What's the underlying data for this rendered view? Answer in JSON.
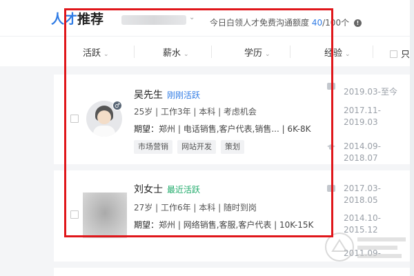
{
  "header": {
    "logo_part1": "人才",
    "logo_part2": "推荐",
    "quota_text": "今日白领人才免费沟通额度",
    "quota_used": "40",
    "quota_total": "/100个"
  },
  "filters": {
    "items": [
      "活跃",
      "薪水",
      "学历",
      "经验"
    ],
    "only_label": "只"
  },
  "candidates": [
    {
      "name": "吴先生",
      "active": "刚刚活跃",
      "meta": "25岁 | 工作3年 | 本科 | 考虑机会",
      "expect_label": "期望：",
      "expect": "郑州 | 电话销售,客户代表,销售... | 6K-8K",
      "tags": [
        "市场营销",
        "网站开发",
        "策划"
      ],
      "experience": [
        "2019.03-至今",
        "2017.11-",
        "2019.03",
        "2014.09-",
        "2018.07"
      ]
    },
    {
      "name": "刘女士",
      "active": "最近活跃",
      "meta": "27岁 | 工作6年 | 本科 | 随时到岗",
      "expect_label": "期望：",
      "expect": "郑州 | 网络销售,客服,客户代表 | 10K-15K",
      "tags": [],
      "experience": [
        "2017.03-",
        "2018.05",
        "2014.10-",
        "2015.12",
        "2011.09-"
      ]
    }
  ],
  "colors": {
    "accent": "#2f7be5",
    "active_green": "#1eaa69",
    "highlight_box": "#e0161a"
  },
  "icons": [
    "chevron-down-icon",
    "info-icon",
    "male-icon",
    "briefcase-icon",
    "graduation-cap-icon"
  ]
}
